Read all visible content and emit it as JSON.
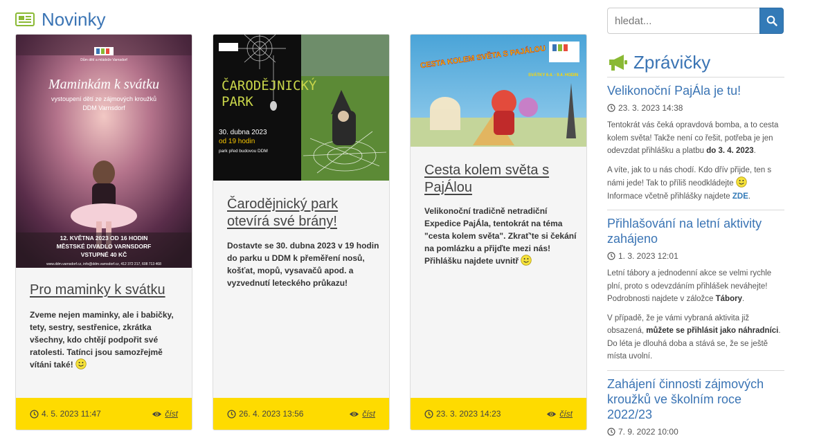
{
  "news": {
    "heading": "Novinky",
    "read_label": "číst",
    "cards": [
      {
        "title": "Pro maminky k svátku",
        "excerpt_part1": "Zveme nejen maminky, ale i babičky, tety, sestry, sestřenice, zkrátka všechny, kdo chtějí podpořit své ratolesti. Tatínci jsou samozřejmě vítáni také!",
        "date": "4. 5. 2023 11:47",
        "image": {
          "logo": "Dům dětí a mládeže Varnsdorf",
          "headline": "Maminkám k svátku",
          "sub1": "vystoupení dětí ze zájmových kroužků",
          "sub2": "DDM Varnsdorf",
          "info1": "12. KVĚTNA 2023 OD 16 HODIN",
          "info2": "MĚSTSKÉ DIVADLO VARNSDORF",
          "info3": "VSTUPNÉ 40 KČ",
          "contact": "www.ddm.varnsdorf.cz, info@ddm.varnsdorf.cz, 412 372 217, 608 713 468"
        }
      },
      {
        "title": "Čarodějnický park otevírá své brány!",
        "excerpt_part1": "Dostavte se 30. dubna 2023 v 19 hodin do parku u DDM k přeměření nosů, košťat, mopů, vysavačů apod. a vyzvednutí leteckého průkazu!",
        "date": "26. 4. 2023 13:56",
        "image": {
          "headline1": "ČARODĚJNICKÝ",
          "headline2": "PARK",
          "date": "30. dubna 2023",
          "time": "od 19 hodin",
          "place": "park před budovou DDM"
        }
      },
      {
        "title": "Cesta kolem světa s PajÁlou",
        "excerpt_part1": "Velikonoční tradičně netradiční Expedice PajÁla, tentokrát na téma \"cesta kolem světa\". Zkrať'te si čekání na pomlázku a přijďte mezi nás! Přihlášku najdete uvnitř",
        "date": "23. 3. 2023 14:23",
        "image": {
          "headline": "CESTA KOLEM SVĚTA S PAJÁLOU",
          "dates": "SVÁTKY 6.4. - 9.4. HODIN"
        }
      }
    ]
  },
  "search": {
    "placeholder": "hledat..."
  },
  "sidebar": {
    "heading": "Zprávičky",
    "items": [
      {
        "title": "Velikonoční PajÁla je tu!",
        "time": "23. 3. 2023 14:38",
        "p1_a": "Tentokrát vás čeká opravdová bomba, a to cesta kolem světa! Takže není co řešit, potřeba je jen odevzdat přihlášku a platbu ",
        "p1_b": "do 3. 4. 2023",
        "p1_c": ".",
        "p2_a": "A víte, jak to u nás chodí. Kdo dřív přijde, ten s námi jede! Tak to příliš neodkládejte",
        "p2_b": "Informace včetně přihlášky najdete ",
        "p2_link": "ZDE",
        "p2_c": "."
      },
      {
        "title": "Přihlašování na letní aktivity zahájeno",
        "time": "1. 3. 2023 12:01",
        "p1_a": "Letní tábory a jednodenní akce se velmi rychle plní, proto s odevzdáním přihlášek neváhejte! Podrobnosti najdete v záložce ",
        "p1_b": "Tábory",
        "p1_c": ".",
        "p2_a": "V případě, že je vámi vybraná aktivita již obsazená, ",
        "p2_b": "můžete se přihlásit jako náhradníci",
        "p2_c": ". Do léta je dlouhá doba a stává se, že se ještě místa uvolní."
      },
      {
        "title": "Zahájení činnosti zájmových kroužků ve školním roce 2022/23",
        "time": "7. 9. 2022 10:00"
      }
    ]
  },
  "colors": {
    "accent": "#3a74b4",
    "footer": "#fedb00",
    "button": "#337ab7",
    "icon_green": "#8ab934"
  }
}
